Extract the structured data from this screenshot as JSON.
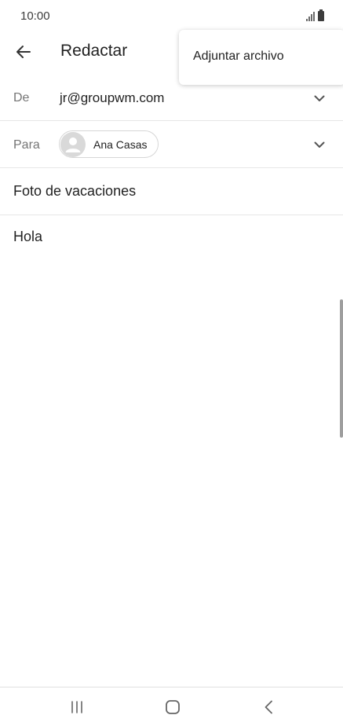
{
  "status_bar": {
    "time": "10:00"
  },
  "header": {
    "title": "Redactar"
  },
  "menu": {
    "items": [
      {
        "label": "Adjuntar archivo"
      }
    ]
  },
  "from": {
    "label": "De",
    "value": "jr@groupwm.com"
  },
  "to": {
    "label": "Para",
    "recipients": [
      {
        "name": "Ana Casas"
      }
    ]
  },
  "subject": {
    "value": "Foto de vacaciones"
  },
  "body": {
    "value": "Hola"
  },
  "icons": {
    "back": "arrow-back-icon",
    "dropdown": "chevron-down-icon",
    "avatar": "person-icon",
    "nav_recent": "recent-apps-icon",
    "nav_home": "home-icon",
    "nav_back": "chevron-left-icon"
  },
  "colors": {
    "text": "#222222",
    "label": "#757575",
    "divider": "#e6e6e6"
  }
}
